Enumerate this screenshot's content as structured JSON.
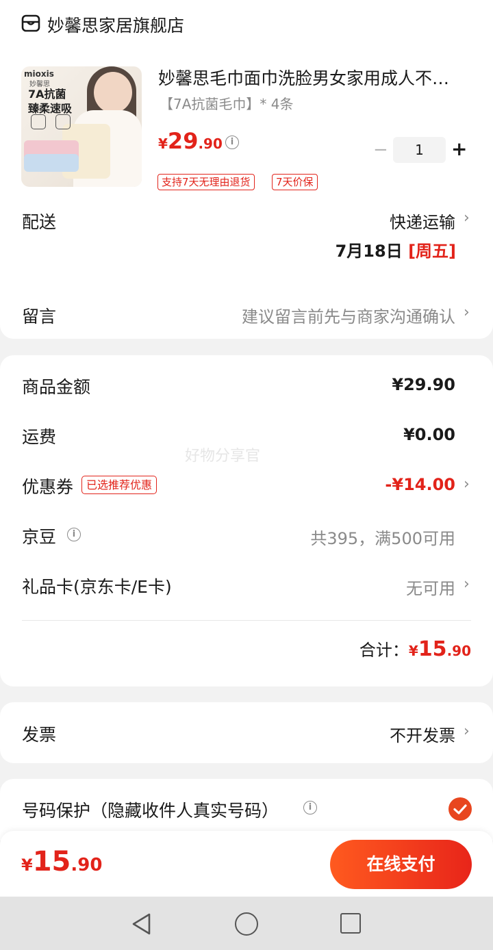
{
  "store": {
    "name": "妙馨思家居旗舰店",
    "icon": "store-icon"
  },
  "product": {
    "title": "妙馨思毛巾面巾洗脸男女家用成人不…",
    "spec": "【7A抗菌毛巾】* 4条",
    "price": {
      "currency": "¥",
      "integer": "29",
      "decimal": ".90"
    },
    "quantity": "1",
    "qty_minus": "−",
    "qty_plus": "+",
    "tags": [
      "支持7天无理由退货",
      "7天价保"
    ],
    "image": {
      "brand": "mioxis",
      "brand_cn": "妙馨思",
      "line1": "7A抗菌",
      "line2": "臻柔速吸"
    }
  },
  "shipping": {
    "label": "配送",
    "method": "快递运输",
    "date": "7月18日",
    "weekday": "[周五]"
  },
  "message": {
    "label": "留言",
    "placeholder": "建议留言前先与商家沟通确认"
  },
  "summary": {
    "goods": {
      "label": "商品金额",
      "value": "¥29.90"
    },
    "freight": {
      "label": "运费",
      "value": "¥0.00"
    },
    "coupon": {
      "label": "优惠券",
      "tag": "已选推荐优惠",
      "value": "-¥14.00"
    },
    "beans": {
      "label": "京豆",
      "value": "共395，满500可用"
    },
    "giftcard": {
      "label": "礼品卡(京东卡/E卡)",
      "value": "无可用"
    },
    "total": {
      "label": "合计：",
      "currency": "¥",
      "integer": "15",
      "decimal": ".90"
    }
  },
  "watermark": "好物分享官",
  "invoice": {
    "label": "发票",
    "value": "不开发票"
  },
  "privacy": {
    "label": "号码保护（隐藏收件人真实号码）",
    "checked": true
  },
  "footer": {
    "price": {
      "currency": "¥",
      "integer": "15",
      "decimal": ".90"
    },
    "pay_button": "在线支付"
  },
  "chevron": "›",
  "info_glyph": "i",
  "colors": {
    "accent": "#e2231a",
    "button_start": "#ff5a1f",
    "button_end": "#e8251a",
    "muted": "#8a8a8a"
  }
}
